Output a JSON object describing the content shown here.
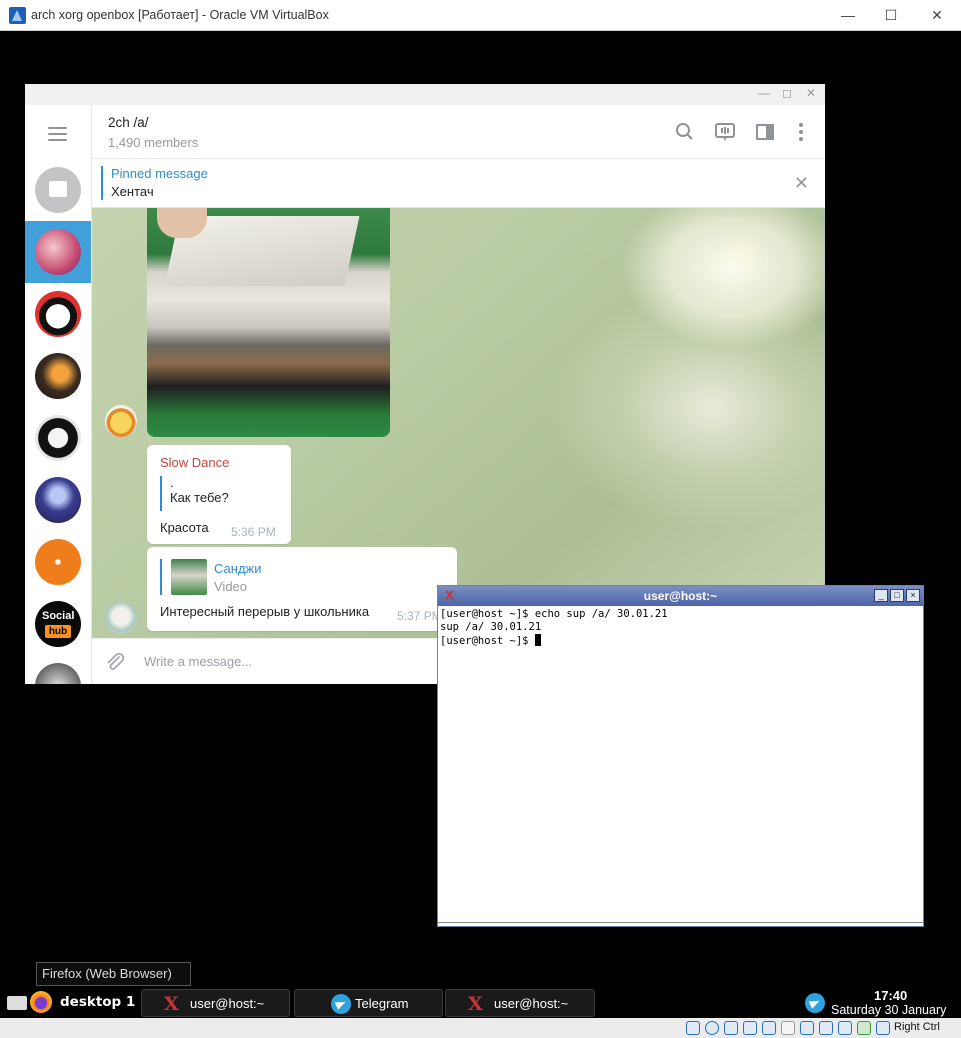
{
  "vbox": {
    "title": "arch xorg openbox [Работает] - Oracle VM VirtualBox",
    "minimize": "—",
    "maximize": "☐",
    "close": "✕",
    "host_key": "Right Ctrl"
  },
  "telegram": {
    "win_min": "—",
    "win_max": "◻",
    "win_close": "✕",
    "chat": {
      "title": "2ch /a/",
      "members": "1,490 members"
    },
    "pinned": {
      "label": "Pinned message",
      "text": "Хентач",
      "close": "✕"
    },
    "messages": [
      {
        "sender": "Slow Dance",
        "reply_line1": ".",
        "reply_line2": "Как тебе?",
        "text": "Красота",
        "time": "5:36 PM"
      },
      {
        "reply_name": "Санджи",
        "reply_type": "Video",
        "text": "Интересный перерыв у школьника",
        "time": "5:37 PM"
      }
    ],
    "compose_placeholder": "Write a message..."
  },
  "xterm": {
    "title": "user@host:~",
    "lines": [
      "[user@host ~]$ echo sup /a/ 30.01.21",
      "sup /a/ 30.01.21",
      "[user@host ~]$ "
    ]
  },
  "taskbar": {
    "tooltip": "Firefox (Web Browser)",
    "desktop": "desktop 1",
    "tasks": [
      {
        "label": "user@host:~"
      },
      {
        "label": "Telegram"
      },
      {
        "label": "user@host:~"
      }
    ],
    "clock": "17:40",
    "date": "Saturday 30 January"
  },
  "colors": {
    "telegram_accent": "#419fd9",
    "sender_red": "#c0463d",
    "xterm_titlebar": "#4d64a6"
  }
}
